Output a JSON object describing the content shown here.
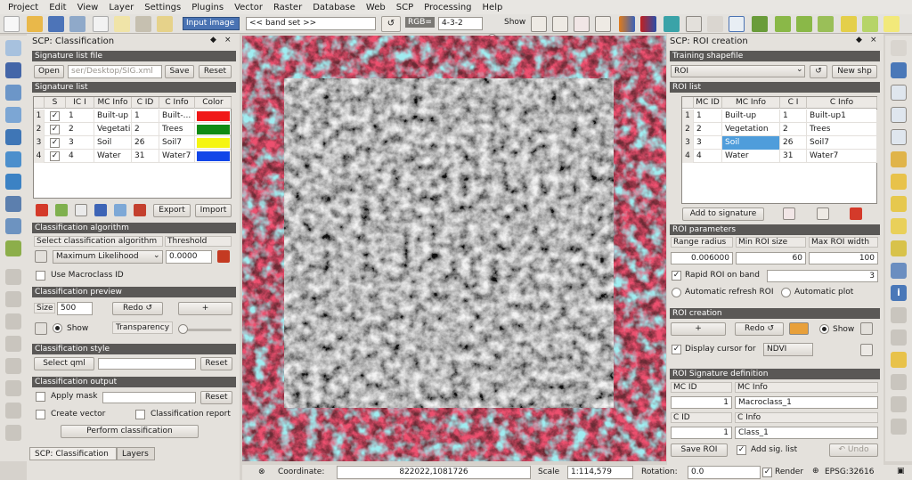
{
  "menu": [
    "Project",
    "Edit",
    "View",
    "Layer",
    "Settings",
    "Plugins",
    "Vector",
    "Raster",
    "Database",
    "Web",
    "SCP",
    "Processing",
    "Help"
  ],
  "toolbar": {
    "input_image_label": "Input image",
    "band_set_value": "<< band set >>",
    "rgb_label": "RGB=",
    "rgb_value": "4-3-2",
    "show_label": "Show"
  },
  "left_panel": {
    "title": "SCP: Classification",
    "signature_file": {
      "header": "Signature list file",
      "open_label": "Open",
      "path_value": "ser/Desktop/SIG.xml",
      "save_label": "Save",
      "reset_label": "Reset"
    },
    "signature_list": {
      "header": "Signature list",
      "columns": [
        "S",
        "IC I",
        "MC Info",
        "C ID",
        "C Info",
        "Color"
      ],
      "rows": [
        {
          "n": "1",
          "mc_id": "1",
          "mc_info": "Built-up",
          "c_id": "1",
          "c_info": "Built-...",
          "color": "#f01818"
        },
        {
          "n": "2",
          "mc_id": "2",
          "mc_info": "Vegetati...",
          "c_id": "2",
          "c_info": "Trees",
          "color": "#0f8a14"
        },
        {
          "n": "3",
          "mc_id": "3",
          "mc_info": "Soil",
          "c_id": "26",
          "c_info": "Soil7",
          "color": "#f5f512"
        },
        {
          "n": "4",
          "mc_id": "4",
          "mc_info": "Water",
          "c_id": "31",
          "c_info": "Water7",
          "color": "#1246e8"
        }
      ],
      "export_label": "Export",
      "import_label": "Import"
    },
    "algorithm": {
      "header": "Classification algorithm",
      "select_label": "Select classification algorithm",
      "threshold_label": "Threshold",
      "algorithm_value": "Maximum Likelihood",
      "threshold_value": "0.0000",
      "macroclass_label": "Use Macroclass ID"
    },
    "preview": {
      "header": "Classification preview",
      "size_label": "Size",
      "size_value": "500",
      "redo_label": "Redo ↺",
      "plus_label": "+",
      "show_label": "Show",
      "transparency_label": "Transparency"
    },
    "style": {
      "header": "Classification style",
      "select_qml_label": "Select qml",
      "reset_label": "Reset"
    },
    "output": {
      "header": "Classification output",
      "apply_mask_label": "Apply mask",
      "reset_label": "Reset",
      "create_vector_label": "Create vector",
      "report_label": "Classification report",
      "perform_label": "Perform classification"
    },
    "tabs": [
      "SCP: Classification",
      "Layers"
    ]
  },
  "right_panel": {
    "title": "SCP: ROI creation",
    "training": {
      "header": "Training shapefile",
      "shapefile_value": "ROI",
      "new_shp_label": "New shp"
    },
    "roi_list": {
      "header": "ROI list",
      "columns": [
        "MC ID",
        "MC Info",
        "C I",
        "C Info"
      ],
      "rows": [
        {
          "n": "1",
          "mc_id": "1",
          "mc_info": "Built-up",
          "c_id": "1",
          "c_info": "Built-up1"
        },
        {
          "n": "2",
          "mc_id": "2",
          "mc_info": "Vegetation",
          "c_id": "2",
          "c_info": "Trees"
        },
        {
          "n": "3",
          "mc_id": "3",
          "mc_info": "Soil",
          "c_id": "26",
          "c_info": "Soil7"
        },
        {
          "n": "4",
          "mc_id": "4",
          "mc_info": "Water",
          "c_id": "31",
          "c_info": "Water7"
        }
      ],
      "add_label": "Add to signature"
    },
    "roi_params": {
      "header": "ROI parameters",
      "range_label": "Range radius",
      "min_size_label": "Min ROI size",
      "max_width_label": "Max ROI width",
      "range_value": "0.006000",
      "min_size_value": "60",
      "max_width_value": "100",
      "rapid_label": "Rapid ROI on band",
      "rapid_value": "3",
      "auto_refresh_label": "Automatic refresh ROI",
      "auto_plot_label": "Automatic  plot"
    },
    "roi_creation": {
      "header": "ROI creation",
      "plus_label": "+",
      "redo_label": "Redo ↺",
      "show_label": "Show",
      "display_cursor_label": "Display cursor for",
      "cursor_value": "NDVI"
    },
    "signature_def": {
      "header": "ROI Signature definition",
      "mc_id_label": "MC ID",
      "mc_info_label": "MC Info",
      "mc_id_value": "1",
      "mc_info_value": "Macroclass_1",
      "c_id_label": "C ID",
      "c_info_label": "C Info",
      "c_id_value": "1",
      "c_info_value": "Class_1",
      "save_roi_label": "Save ROI",
      "add_sig_label": "Add sig. list",
      "undo_label": "↶ Undo"
    }
  },
  "status": {
    "coordinate_label": "Coordinate:",
    "coordinate_value": "822022,1081726",
    "scale_label": "Scale",
    "scale_value": "1:114,579",
    "rotation_label": "Rotation:",
    "rotation_value": "0.0",
    "render_label": "Render",
    "epsg_label": "EPSG:32616"
  }
}
